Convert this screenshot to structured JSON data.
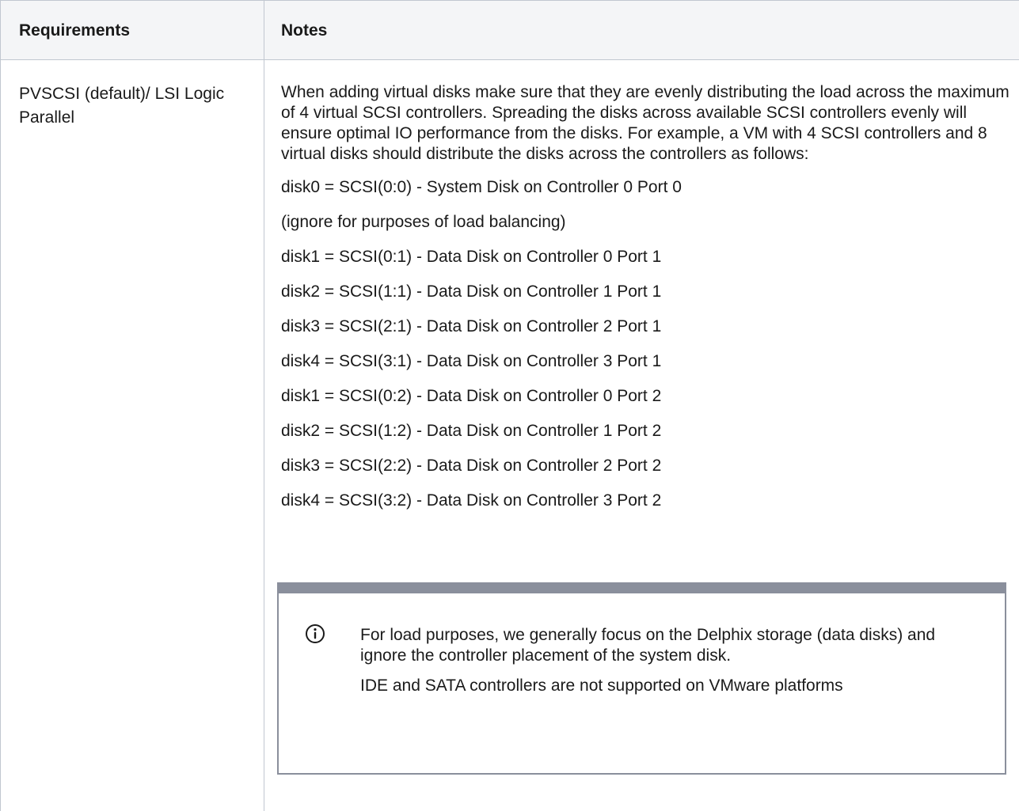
{
  "table": {
    "headers": {
      "requirements": "Requirements",
      "notes": "Notes"
    },
    "row": {
      "requirement": "PVSCSI (default)/ LSI Logic Parallel",
      "intro": "When adding virtual disks make sure that they are evenly distributing the load across the maximum of 4 virtual SCSI controllers. Spreading the disks across available SCSI controllers evenly will ensure optimal IO performance from the disks. For example, a VM with 4 SCSI controllers and 8 virtual disks should distribute the disks across the controllers as follows:",
      "lines": [
        "disk0 = SCSI(0:0) - System Disk on Controller 0 Port 0",
        "(ignore for purposes of load balancing)",
        "disk1 = SCSI(0:1) - Data Disk on Controller 0 Port 1",
        "disk2 = SCSI(1:1) - Data Disk on Controller 1 Port 1",
        "disk3 = SCSI(2:1) - Data Disk on Controller 2 Port 1",
        "disk4 = SCSI(3:1) - Data Disk on Controller 3 Port 1",
        "disk1 = SCSI(0:2) - Data Disk on Controller 0 Port 2",
        "disk2 = SCSI(1:2) - Data Disk on Controller 1 Port 2",
        "disk3 = SCSI(2:2) - Data Disk on Controller 2 Port 2",
        "disk4 = SCSI(3:2) - Data Disk on Controller 3 Port 2"
      ],
      "info_panel": {
        "icon": "info-icon",
        "paragraphs": [
          "For load purposes, we generally focus on the Delphix storage (data disks) and ignore the controller placement of the system disk.",
          "IDE and SATA controllers are not supported on VMware platforms"
        ]
      }
    }
  },
  "colors": {
    "header_bg": "#f4f5f7",
    "border": "#c1c7d0",
    "panel_border": "#8a8f9c",
    "text": "#1a1a1a"
  }
}
